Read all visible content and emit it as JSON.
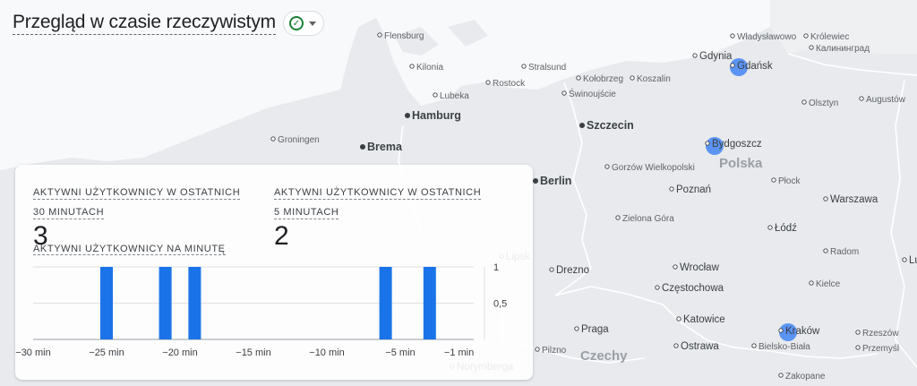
{
  "header": {
    "title": "Przegląd w czasie rzeczywistym",
    "status_icon": "check-circle-icon",
    "status_color": "#188038"
  },
  "map": {
    "cities": [
      {
        "name": "Władysławowo",
        "size": "small"
      },
      {
        "name": "Królewiec",
        "size": "small"
      },
      {
        "name": "Калининград",
        "size": "small"
      },
      {
        "name": "Gdynia",
        "size": "mid"
      },
      {
        "name": "Gdańsk",
        "size": "mid"
      },
      {
        "name": "Flensburg",
        "size": "small"
      },
      {
        "name": "Kilonia",
        "size": "small"
      },
      {
        "name": "Stralsund",
        "size": "small"
      },
      {
        "name": "Kołobrzeg",
        "size": "small"
      },
      {
        "name": "Koszalin",
        "size": "small"
      },
      {
        "name": "Rostock",
        "size": "small"
      },
      {
        "name": "Świnoujście",
        "size": "small"
      },
      {
        "name": "Lubeka",
        "size": "small"
      },
      {
        "name": "Olsztyn",
        "size": "small"
      },
      {
        "name": "Augustów",
        "size": "small"
      },
      {
        "name": "Hamburg",
        "size": "big"
      },
      {
        "name": "Szczecin",
        "size": "big"
      },
      {
        "name": "Groningen",
        "size": "small"
      },
      {
        "name": "Brema",
        "size": "big"
      },
      {
        "name": "Bydgoszcz",
        "size": "mid"
      },
      {
        "name": "Gorzów Wielkopolski",
        "size": "small"
      },
      {
        "name": "Berlin",
        "size": "big"
      },
      {
        "name": "Płock",
        "size": "small"
      },
      {
        "name": "Poznań",
        "size": "mid"
      },
      {
        "name": "Warszawa",
        "size": "mid"
      },
      {
        "name": "Zielona Góra",
        "size": "small"
      },
      {
        "name": "Łódź",
        "size": "mid"
      },
      {
        "name": "Radom",
        "size": "small"
      },
      {
        "name": "Lublin",
        "size": "mid"
      },
      {
        "name": "Drezno",
        "size": "mid"
      },
      {
        "name": "Wrocław",
        "size": "mid"
      },
      {
        "name": "Częstochowa",
        "size": "mid"
      },
      {
        "name": "Kielce",
        "size": "small"
      },
      {
        "name": "Praga",
        "size": "mid"
      },
      {
        "name": "Katowice",
        "size": "mid"
      },
      {
        "name": "Kraków",
        "size": "mid"
      },
      {
        "name": "Rzeszów",
        "size": "small"
      },
      {
        "name": "Przemyśl",
        "size": "small"
      },
      {
        "name": "Ostrawa",
        "size": "mid"
      },
      {
        "name": "Bielsko-Biała",
        "size": "small"
      },
      {
        "name": "Pilzno",
        "size": "small"
      },
      {
        "name": "Zakopane",
        "size": "small"
      },
      {
        "name": "Norymberga",
        "size": "mid"
      },
      {
        "name": "Lipsk",
        "size": "mid"
      }
    ],
    "countries": [
      "Polska",
      "Czechy"
    ],
    "active_dot_color": "#4285f4",
    "active_cities": [
      "Gdańsk",
      "Bydgoszcz",
      "Kraków"
    ]
  },
  "card": {
    "metric30": {
      "label_line1": "AKTYWNI UŻYTKOWNICY W OSTATNICH",
      "label_line2": "30 MINUTACH",
      "value": "3"
    },
    "metric5": {
      "label_line1": "AKTYWNI UŻYTKOWNICY W OSTATNICH",
      "label_line2": "5 MINUTACH",
      "value": "2"
    },
    "per_minute_label": "AKTYWNI UŻYTKOWNICY NA MINUTĘ"
  },
  "chart_data": {
    "type": "bar",
    "title": "AKTYWNI UŻYTKOWNICY NA MINUTĘ",
    "x_range": [
      -30,
      0
    ],
    "x_ticks": [
      "−30 min",
      "−25 min",
      "−20 min",
      "−15 min",
      "−10 min",
      "−5 min",
      "−1 min"
    ],
    "x_tick_values": [
      -30,
      -25,
      -20,
      -15,
      -10,
      -5,
      -1
    ],
    "y_ticks": [
      "1",
      "0,5"
    ],
    "y_tick_values": [
      1,
      0.5
    ],
    "ylim": [
      0,
      1
    ],
    "bars": [
      {
        "minute": -25,
        "value": 1
      },
      {
        "minute": -21,
        "value": 1
      },
      {
        "minute": -19,
        "value": 1
      },
      {
        "minute": -6,
        "value": 1
      },
      {
        "minute": -3,
        "value": 1
      }
    ],
    "bar_color": "#1a73e8",
    "grid": true
  }
}
